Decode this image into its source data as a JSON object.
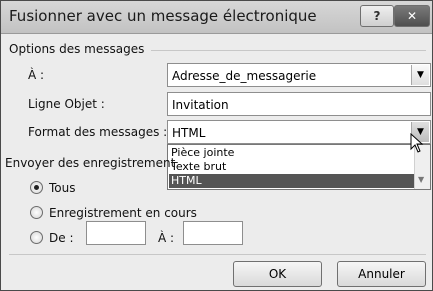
{
  "window": {
    "title": "Fusionner avec un message électronique",
    "help_glyph": "?",
    "close_glyph": "✕"
  },
  "options": {
    "section_title": "Options des messages",
    "a_label": "À :",
    "a_value": "Adresse_de_messagerie",
    "subject_label": "Ligne Objet :",
    "subject_value": "Invitation",
    "format_label": "Format des messages :",
    "format_value": "HTML",
    "format_options": [
      "Pièce jointe",
      "Texte brut",
      "HTML"
    ]
  },
  "records": {
    "section_title": "Envoyer des enregistrement",
    "all_label": "Tous",
    "current_label": "Enregistrement en cours",
    "from_label": "De :",
    "to_label": "À :",
    "selected": "Tous"
  },
  "buttons": {
    "ok": "OK",
    "cancel": "Annuler"
  },
  "colors": {
    "selected_item": "#555555",
    "close_button": "#5a5a5a"
  }
}
